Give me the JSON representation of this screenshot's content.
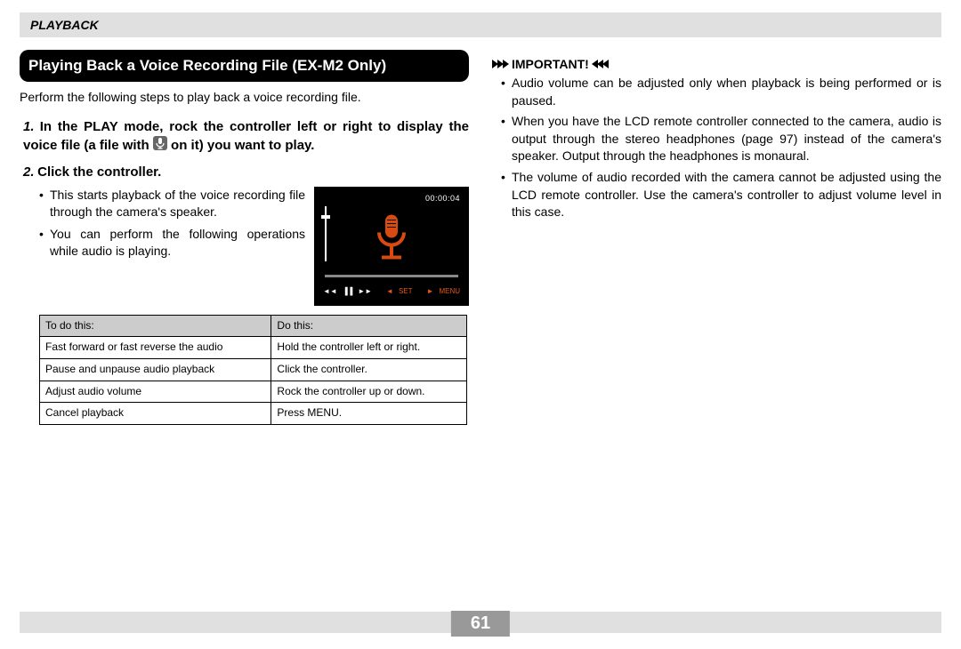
{
  "section_header": "PLAYBACK",
  "topic_heading": "Playing Back a Voice Recording File (EX-M2 Only)",
  "intro": "Perform the following steps to play back a voice recording file.",
  "step1_num": "1.",
  "step1_pre": "In the PLAY mode, rock the controller left or right to display the voice file (a file with ",
  "step1_post": " on it) you want to play.",
  "step2_num": "2.",
  "step2_text": "Click the controller.",
  "step2_bullets": [
    "This starts playback of the voice recording file through the camera's speaker.",
    "You can perform the following operations while audio is playing."
  ],
  "lcd_timecode": "00:00:04",
  "lcd_ctrl_left1": "◄◄",
  "lcd_ctrl_left2": "▐▐",
  "lcd_ctrl_left3": "►►",
  "lcd_ctrl_set_arrow": "◄",
  "lcd_ctrl_set": "SET",
  "lcd_ctrl_menu_arrow": "►",
  "lcd_ctrl_menu": "MENU",
  "table": {
    "h1": "To do this:",
    "h2": "Do this:",
    "rows": [
      [
        "Fast forward or fast reverse the audio",
        "Hold the controller left or right."
      ],
      [
        "Pause and unpause audio playback",
        "Click the controller."
      ],
      [
        "Adjust audio volume",
        "Rock the controller up or down."
      ],
      [
        "Cancel playback",
        "Press MENU."
      ]
    ]
  },
  "important_label": "IMPORTANT!",
  "important": [
    "Audio volume can be adjusted only when playback is being performed or is paused.",
    "When you have the LCD remote controller connected to the camera, audio is output through the stereo headphones (page 97) instead of the camera's speaker. Output through the headphones is monaural.",
    "The volume of audio recorded with the camera cannot be adjusted using the LCD remote controller. Use the camera's controller to adjust volume level in this case."
  ],
  "page_number": "61"
}
